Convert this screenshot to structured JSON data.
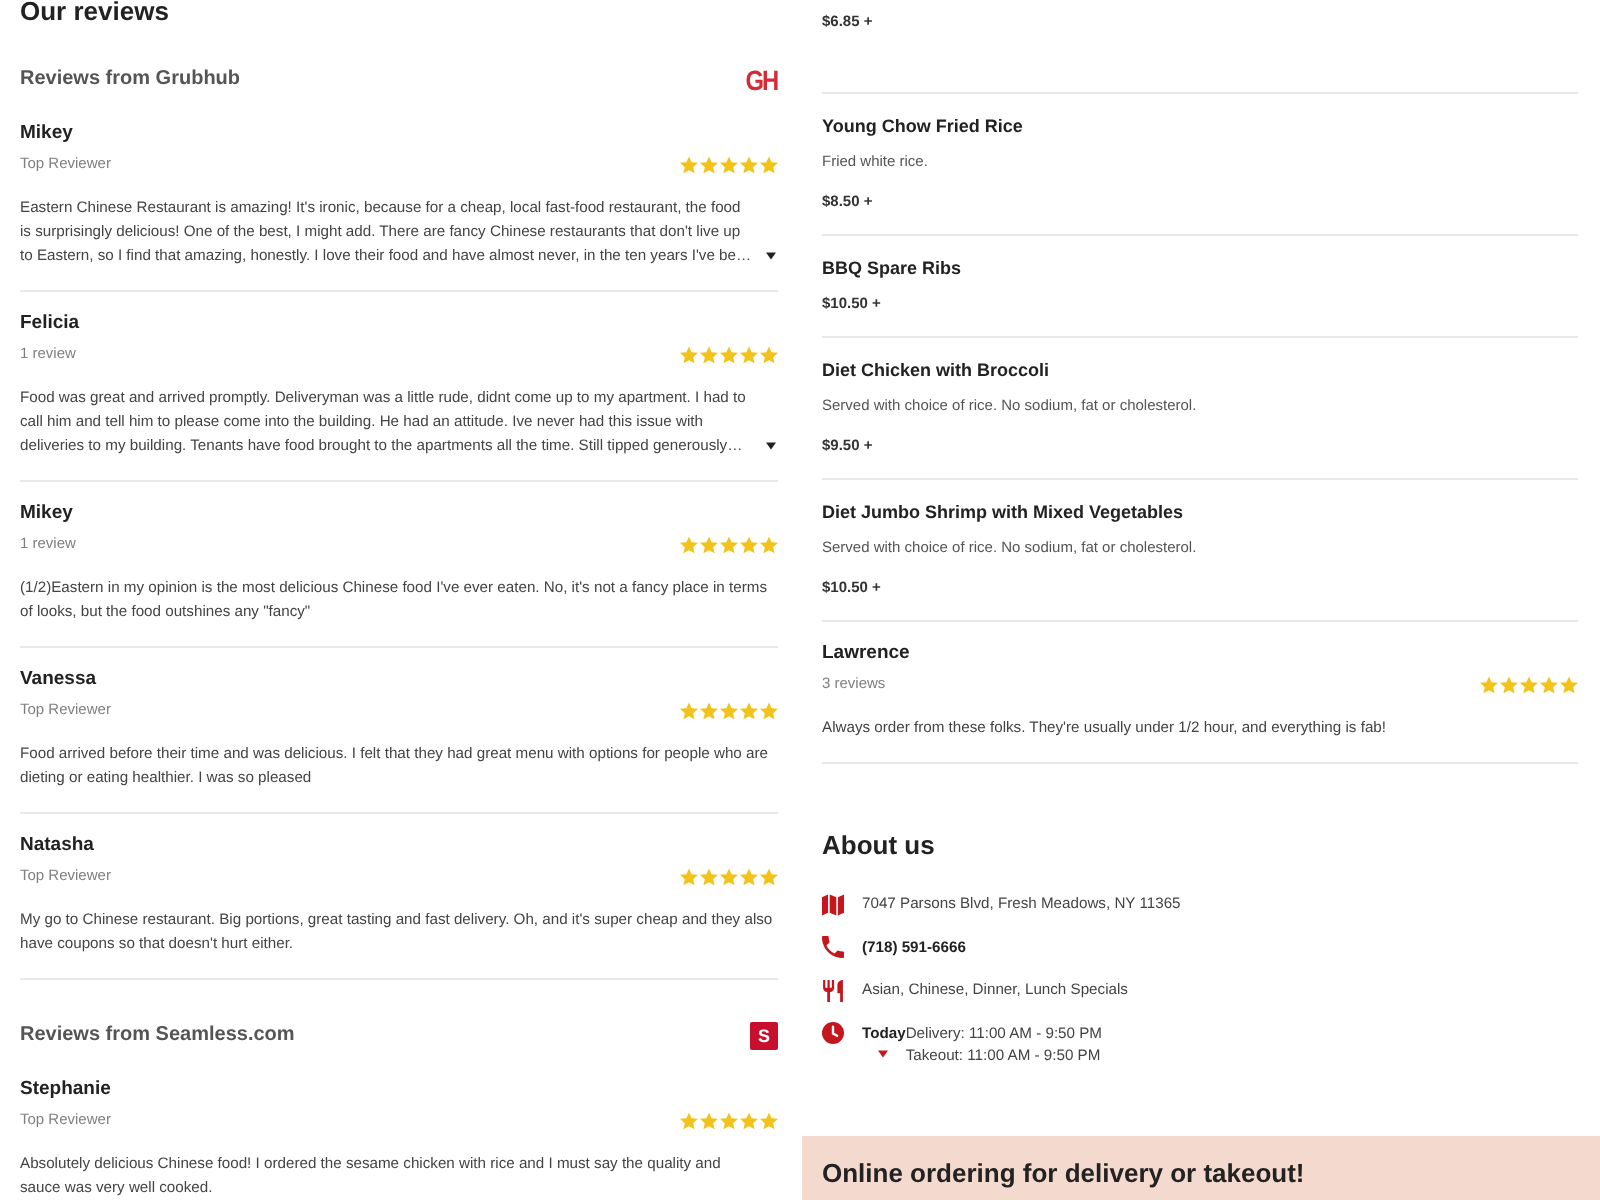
{
  "reviews_section": {
    "title": "Our reviews",
    "sources": [
      {
        "heading": "Reviews from Grubhub",
        "logo": {
          "kind": "letters",
          "text": "GH"
        },
        "reviews": [
          {
            "name": "Mikey",
            "subtitle": "Top Reviewer",
            "stars": 5,
            "text": "Eastern Chinese Restaurant is amazing! It's ironic, because for a cheap, local fast-food restaurant, the food is surprisingly delicious! One of the best, I might add. There are fancy Chinese restaurants that don't live up to Eastern, so I find that amazing, honestly. I love their food and have almost never, in the ten years I've be…",
            "expandable": true
          },
          {
            "name": "Felicia",
            "subtitle": "1 review",
            "stars": 5,
            "text": "Food was great and arrived promptly. Deliveryman was a little rude, didnt come up to my apartment. I had to call him and tell him to please come into the building. He had an attitude. Ive never had this issue with deliveries to my building. Tenants have food brought to the apartments all the time. Still tipped generously…",
            "expandable": true
          },
          {
            "name": "Mikey",
            "subtitle": "1 review",
            "stars": 5,
            "text": "(1/2)Eastern in my opinion is the most delicious Chinese food I've ever eaten. No, it's not a fancy place in terms of looks, but the food outshines any \"fancy\"",
            "expandable": false
          },
          {
            "name": "Vanessa",
            "subtitle": "Top Reviewer",
            "stars": 5,
            "text": "Food arrived before their time and was delicious. I felt that they had great menu with options for people who are dieting or eating healthier. I was so pleased",
            "expandable": false
          },
          {
            "name": "Natasha",
            "subtitle": "Top Reviewer",
            "stars": 5,
            "text": "My go to Chinese restaurant. Big portions, great tasting and fast delivery. Oh, and it's super cheap and they also have coupons so that doesn't hurt either.",
            "expandable": false
          }
        ]
      },
      {
        "heading": "Reviews from Seamless.com",
        "logo": {
          "kind": "badge",
          "text": "S"
        },
        "reviews": [
          {
            "name": "Stephanie",
            "subtitle": "Top Reviewer",
            "stars": 5,
            "text": "Absolutely delicious Chinese food! I ordered the sesame chicken with rice and I must say the quality and sauce was very well cooked.",
            "expandable": false
          }
        ]
      }
    ]
  },
  "menu_items": [
    {
      "price": "$6.85 +"
    },
    {
      "name": "Young Chow Fried Rice",
      "description": "Fried white rice.",
      "price": "$8.50 +"
    },
    {
      "name": "BBQ Spare Ribs",
      "price": "$10.50 +"
    },
    {
      "name": "Diet Chicken with Broccoli",
      "description": "Served with choice of rice. No sodium, fat or cholesterol.",
      "price": "$9.50 +"
    },
    {
      "name": "Diet Jumbo Shrimp with Mixed Vegetables",
      "description": "Served with choice of rice. No sodium, fat or cholesterol.",
      "price": "$10.50 +"
    }
  ],
  "more_reviews": [
    {
      "name": "Lawrence",
      "subtitle": "3 reviews",
      "stars": 5,
      "text": "Always order from these folks. They're usually under 1/2 hour, and everything is fab!",
      "expandable": false
    }
  ],
  "about": {
    "title": "About us",
    "details": [
      {
        "kind": "address",
        "text": "7047 Parsons Blvd, Fresh Meadows, NY 11365"
      },
      {
        "kind": "phone",
        "text": "(718) 591-6666"
      },
      {
        "kind": "cuisines",
        "text": "Asian, Chinese, Dinner, Lunch Specials"
      }
    ],
    "hours": {
      "day": "Today",
      "lines": [
        "Delivery: 11:00 AM - 9:50 PM",
        "Takeout: 11:00 AM - 9:50 PM"
      ]
    }
  },
  "banner": {
    "title": "Online ordering for delivery or takeout!"
  }
}
